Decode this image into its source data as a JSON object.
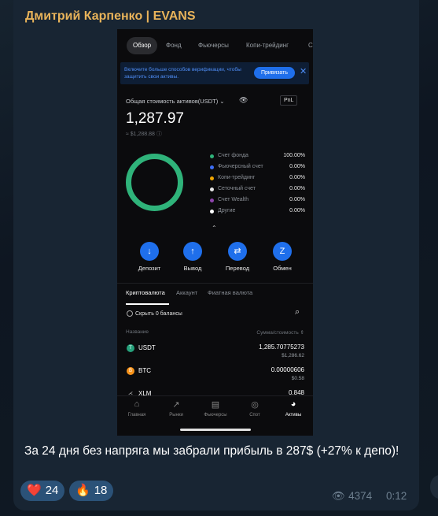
{
  "message": {
    "author": "Дмитрий Карпенко | EVANS",
    "text": "За 24 дня без напряга мы забрали прибыль в 287$ (+27% к депо)!",
    "reactions": [
      {
        "emoji": "❤️",
        "count": "24"
      },
      {
        "emoji": "🔥",
        "count": "18"
      }
    ],
    "views": "4374",
    "time": "0:12"
  },
  "screenshot": {
    "tabs": [
      "Обзор",
      "Фонд",
      "Фьючерсы",
      "Копи-трейдинг",
      "С"
    ],
    "banner": {
      "text": "Включите больше способов верификации, чтобы защитить свои активы.",
      "button": "Привязать",
      "close": "✕"
    },
    "total": {
      "label": "Общая стоимость активов(USDT) ⌄",
      "eye": "👁",
      "pnl": "PnL",
      "value": "1,287.97",
      "sub": "≈ $1,288.88 ⓘ"
    },
    "legend": [
      {
        "label": "Счет фонда",
        "value": "100.00%",
        "color": "#2fb37a"
      },
      {
        "label": "Фьючерсный счет",
        "value": "0.00%",
        "color": "#3d6ef5"
      },
      {
        "label": "Копи-трейдинг",
        "value": "0.00%",
        "color": "#f0a500"
      },
      {
        "label": "Сеточный счет",
        "value": "0.00%",
        "color": "#e8e8e8"
      },
      {
        "label": "Счет Wealth",
        "value": "0.00%",
        "color": "#8e44ad"
      },
      {
        "label": "Другие",
        "value": "0.00%",
        "color": "#ffffff"
      }
    ],
    "caret": "⌃",
    "actions": [
      {
        "label": "Депозит",
        "icon": "↓"
      },
      {
        "label": "Вывод",
        "icon": "↑"
      },
      {
        "label": "Перевод",
        "icon": "⇄"
      },
      {
        "label": "Обмен",
        "icon": "Z"
      }
    ],
    "subtabs": [
      "Криптовалюта",
      "Аккаунт",
      "Фиатная валюта"
    ],
    "hide_zero": "Скрыть 0 балансы",
    "search": "⌕",
    "columns": {
      "name": "Название",
      "sum": "Сумма/стоимость ⇕"
    },
    "assets": [
      {
        "name": "USDT",
        "amount": "1,285.70775273",
        "usd": "$1,286.62",
        "color": "#26a17b",
        "icon": "T"
      },
      {
        "name": "BTC",
        "amount": "0.00000606",
        "usd": "$0.58",
        "color": "#f7931a",
        "icon": "B"
      },
      {
        "name": "XLM",
        "amount": "0.848",
        "usd": "",
        "color": "#0b0b0d",
        "icon": "⋌"
      }
    ],
    "nav": [
      {
        "label": "Главная",
        "icon": "⌂"
      },
      {
        "label": "Рынки",
        "icon": "↗"
      },
      {
        "label": "Фьючерсы",
        "icon": "▤"
      },
      {
        "label": "Спот",
        "icon": "◎"
      },
      {
        "label": "Активы",
        "icon": "◕"
      }
    ]
  }
}
